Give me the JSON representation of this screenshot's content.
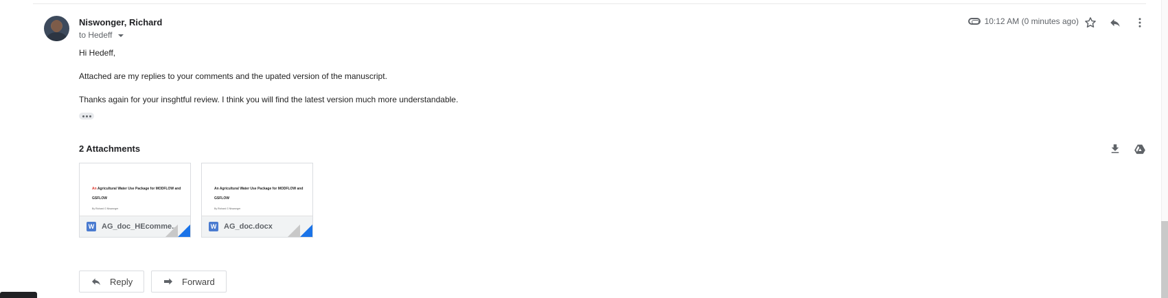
{
  "message": {
    "sender_name": "Niswonger, Richard",
    "recipient_label": "to Hedeff",
    "time": "10:12 AM (0 minutes ago)",
    "greeting": "Hi Hedeff,",
    "paragraph_1": "Attached are my replies to your comments and the upated version of the manuscript.",
    "paragraph_2": "Thanks again for your insghtful review. I think you will find the latest version much more understandable."
  },
  "attachments": {
    "title": "2 Attachments",
    "items": [
      {
        "name": "AG_doc_HEcomme...",
        "preview_title_red": "An",
        "preview_title_line1": " Agricultural Water Use Package for MODFLOW and",
        "preview_title_line2": "GSFLOW",
        "preview_author": "By Richard G Niswonger",
        "type_icon": "W"
      },
      {
        "name": "AG_doc.docx",
        "preview_title_red": "",
        "preview_title_line1": "An Agricultural Water Use Package for MODFLOW and",
        "preview_title_line2": "GSFLOW",
        "preview_author": "By Richard G Niswonger",
        "type_icon": "W"
      }
    ]
  },
  "actions": {
    "reply_label": "Reply",
    "forward_label": "Forward"
  },
  "icons": {
    "attachment": "paperclip-icon",
    "star": "star-icon",
    "reply": "reply-icon",
    "more": "more-vert-icon",
    "download": "download-icon",
    "drive": "drive-icon"
  },
  "colors": {
    "accent_blue": "#1a73e8",
    "word_blue": "#4a7bd0",
    "preview_red": "#d93025"
  }
}
